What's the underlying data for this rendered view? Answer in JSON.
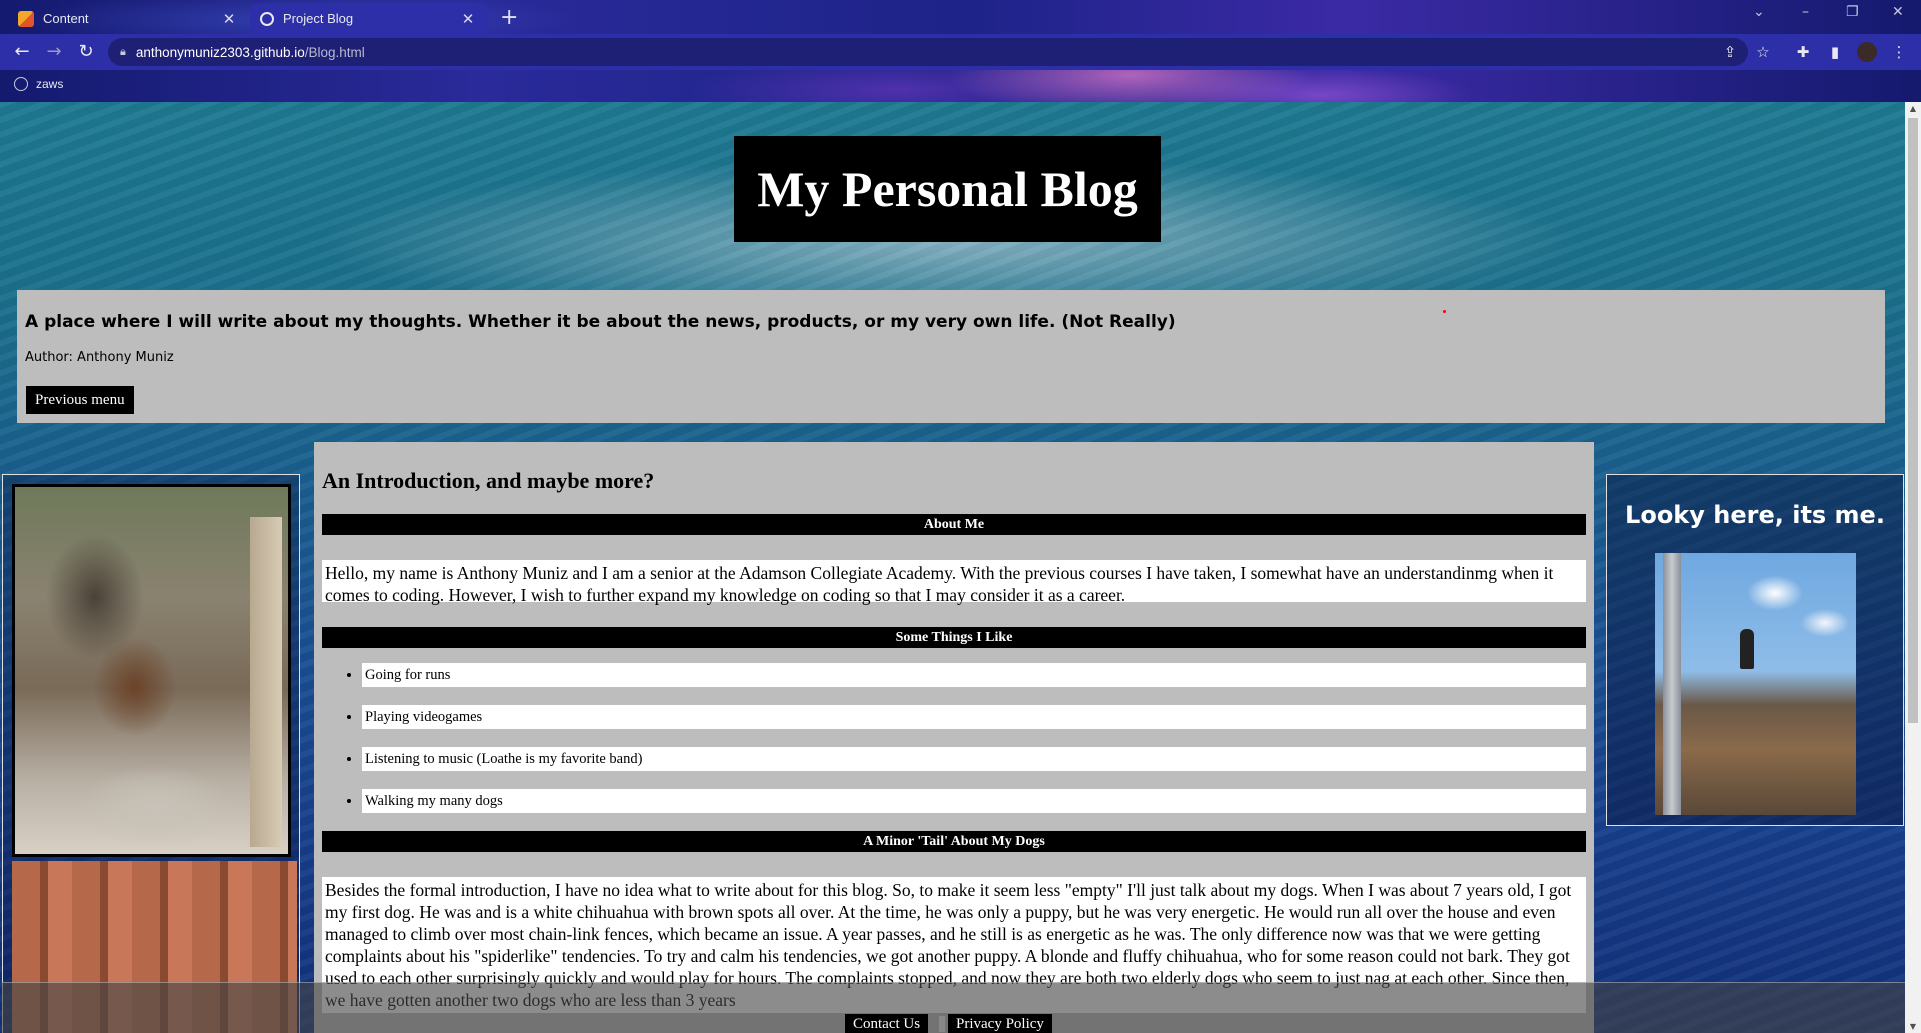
{
  "browser": {
    "tabs": [
      {
        "label": "Content",
        "active": false,
        "favicon": "content-app-icon"
      },
      {
        "label": "Project Blog",
        "active": true,
        "favicon": "globe-icon"
      }
    ],
    "url": {
      "host": "anthonymuniz2303.github.io",
      "path": "/Blog.html"
    },
    "bookmarks": [
      {
        "label": "zaws",
        "icon": "globe-icon"
      }
    ],
    "theme_colors": {
      "toolbar": "#2d2fa8",
      "omnibox": "#1e2075"
    }
  },
  "page": {
    "site_title": "My Personal Blog",
    "tagline": "A place where I will write about my thoughts. Whether it be about the news, products, or my very own life. (Not Really)",
    "author": "Author: Anthony Muniz",
    "prev_button": "Previous menu",
    "main": {
      "heading": "An Introduction, and maybe more?",
      "about_heading": "About Me",
      "about_text": "Hello, my name is Anthony Muniz and I am a senior at the Adamson Collegiate Academy. With the previous courses I have taken, I somewhat have an understandinmg when it comes to coding. However, I wish to further expand my knowledge on coding so that I may consider it as a career.",
      "likes_heading": "Some Things I Like",
      "likes": [
        "Going for runs",
        "Playing videogames",
        "Listening to music (Loathe is my favorite band)",
        "Walking my many dogs"
      ],
      "dogs_heading": "A Minor 'Tail' About My Dogs",
      "dogs_text": "Besides the formal introduction, I have no idea what to write about for this blog. So, to make it seem less \"empty\" I'll just talk about my dogs. When I was about 7 years old, I got my first dog. He was and is a white chihuahua with brown spots all over. At the time, he was only a puppy, but he was very energetic. He would run all over the house and even managed to climb over most chain-link fences, which became an issue. A year passes, and he still is as energetic as he was. The only difference now was that we were getting complaints about his \"spiderlike\" tendencies. To try and calm his tendencies, we got another puppy. A blonde and fluffy chihuahua, who for some reason could not bark. They got used to each other surprisingly quickly and would play for hours. The complaints stopped, and now they are both two elderly dogs who seem to just nag at each other. Since then, we have gotten another two dogs who are less than 3 years"
    },
    "right_caption": "Looky here, its me.",
    "footer": {
      "contact": "Contact Us",
      "privacy": "Privacy Policy"
    }
  }
}
